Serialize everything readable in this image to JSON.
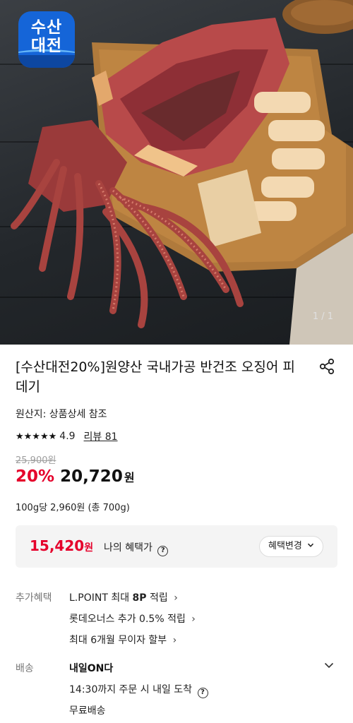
{
  "brand": {
    "line1": "수산",
    "line2": "대전"
  },
  "image": {
    "counter": "1 / 1"
  },
  "product": {
    "title": "[수산대전20%]원양산 국내가공 반건조 오징어 피데기",
    "origin": "원산지: 상품상세 참조",
    "rating": "4.9",
    "review_link": "리뷰 81",
    "original_price": "25,900원",
    "discount": "20%",
    "price": "20,720",
    "price_unit": "원",
    "unit_price": "100g당 2,960원 (총 700g)"
  },
  "benefit": {
    "price": "15,420",
    "price_unit": "원",
    "label": "나의 혜택가",
    "change_button": "혜택변경"
  },
  "extra": {
    "label": "추가혜택",
    "items": [
      {
        "prefix": "L.POINT 최대 ",
        "strong": "8P",
        "suffix": " 적립"
      },
      {
        "prefix": "롯데오너스 추가 0.5% 적립",
        "strong": "",
        "suffix": ""
      },
      {
        "prefix": "최대 6개월 무이자 할부",
        "strong": "",
        "suffix": ""
      }
    ]
  },
  "shipping": {
    "label": "배송",
    "type": "내일ON다",
    "arrival": "14:30까지 주문 시 내일 도착",
    "fee": "무료배송"
  },
  "icons": [
    "share-icon",
    "help-icon",
    "chevron-down-icon",
    "chevron-right-icon",
    "star-icon"
  ],
  "colors": {
    "accent_red": "#e5002b",
    "benefit_bg": "#f4f4f4"
  }
}
